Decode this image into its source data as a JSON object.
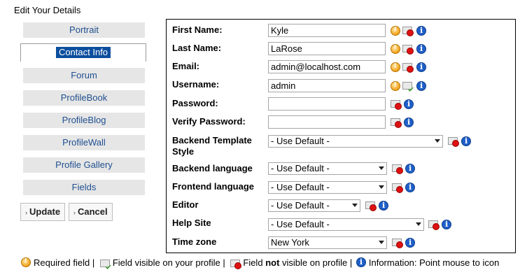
{
  "page": {
    "title": "Edit Your Details"
  },
  "tabs": {
    "portrait": "Portrait",
    "contact_info": "Contact Info",
    "forum": "Forum",
    "profilebook": "ProfileBook",
    "profileblog": "ProfileBlog",
    "profilewall": "ProfileWall",
    "profile_gallery": "Profile Gallery",
    "fields": "Fields"
  },
  "buttons": {
    "update": "Update",
    "cancel": "Cancel"
  },
  "form": {
    "first_name": {
      "label": "First Name:",
      "value": "Kyle"
    },
    "last_name": {
      "label": "Last Name:",
      "value": "LaRose"
    },
    "email": {
      "label": "Email:",
      "value": "admin@localhost.com"
    },
    "username": {
      "label": "Username:",
      "value": "admin"
    },
    "password": {
      "label": "Password:",
      "value": ""
    },
    "verify_password": {
      "label": "Verify Password:",
      "value": ""
    },
    "backend_template": {
      "label_line1": "Backend Template",
      "label_line2": "Style",
      "value": "- Use Default -"
    },
    "backend_language": {
      "label": "Backend language",
      "value": "- Use Default -"
    },
    "frontend_language": {
      "label": "Frontend language",
      "value": "- Use Default -"
    },
    "editor": {
      "label": "Editor",
      "value": "- Use Default -"
    },
    "help_site": {
      "label": "Help Site",
      "value": "- Use Default -"
    },
    "time_zone": {
      "label": "Time zone",
      "value": "New York"
    }
  },
  "legend": {
    "required": "Required field |",
    "visible": "Field visible on your profile |",
    "not_visible_pre": "Field",
    "not_visible_bold": "not",
    "not_visible_post": "visible on profile |",
    "info": "Information: Point mouse to icon"
  },
  "icons": {
    "required": "exclamation-circle-icon",
    "visible": "profile-visible-icon",
    "not_visible": "profile-not-visible-icon",
    "info": "info-icon"
  },
  "colors": {
    "tab_text": "#1f4f8f",
    "active_tab_bg": "#0b4e9e",
    "tab_bg": "#e6e6e6",
    "info": "#1f5fc7",
    "required": "#f3a21b"
  }
}
